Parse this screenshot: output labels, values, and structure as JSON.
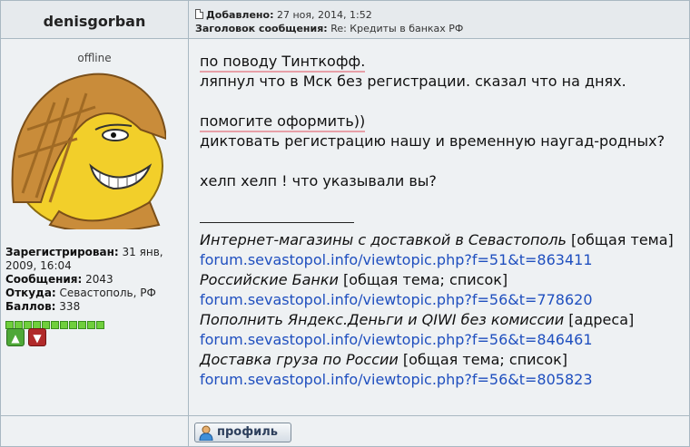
{
  "author": {
    "name": "denisgorban",
    "status": "offline",
    "registered_label": "Зарегистрирован:",
    "registered_value": "31 янв, 2009, 16:04",
    "posts_label": "Сообщения:",
    "posts_value": "2043",
    "from_label": "Откуда:",
    "from_value": "Севастополь, РФ",
    "points_label": "Баллов:",
    "points_value": "338",
    "reputation_segments": 11
  },
  "post": {
    "added_label": "Добавлено:",
    "added_value": "27 ноя, 2014, 1:52",
    "subject_label": "Заголовок сообщения:",
    "subject_value": "Re: Кредиты в банках РФ"
  },
  "message": {
    "line1": "по поводу Тинткофф.",
    "line2": "ляпнул что в Мск без регистрации. сказал что на днях.",
    "line3": "помогите оформить))",
    "line4": "диктовать регистрацию нашу и временную наугад-родных?",
    "line5": "хелп хелп ! что указывали вы?"
  },
  "signature": {
    "items": [
      {
        "title": "Интернет-магазины с доставкой в Севастополь",
        "tag": "[общая тема]",
        "link": "forum.sevastopol.info/viewtopic.php?f=51&t=863411"
      },
      {
        "title": "Российские Банки",
        "tag": "[общая тема; список]",
        "link": "forum.sevastopol.info/viewtopic.php?f=56&t=778620"
      },
      {
        "title": "Пополнить Яндекс.Деньги и QIWI без комиссии",
        "tag": "[адреса]",
        "link": "forum.sevastopol.info/viewtopic.php?f=56&t=846461"
      },
      {
        "title": "Доставка груза по России",
        "tag": "[общая тема; список]",
        "link": "forum.sevastopol.info/viewtopic.php?f=56&t=805823"
      }
    ]
  },
  "buttons": {
    "profile_label": "профиль"
  },
  "colors": {
    "link": "#1f4fbf",
    "reputation": "#6fcf3c",
    "vote_up": "#4ea837",
    "vote_down": "#b12a2a"
  }
}
